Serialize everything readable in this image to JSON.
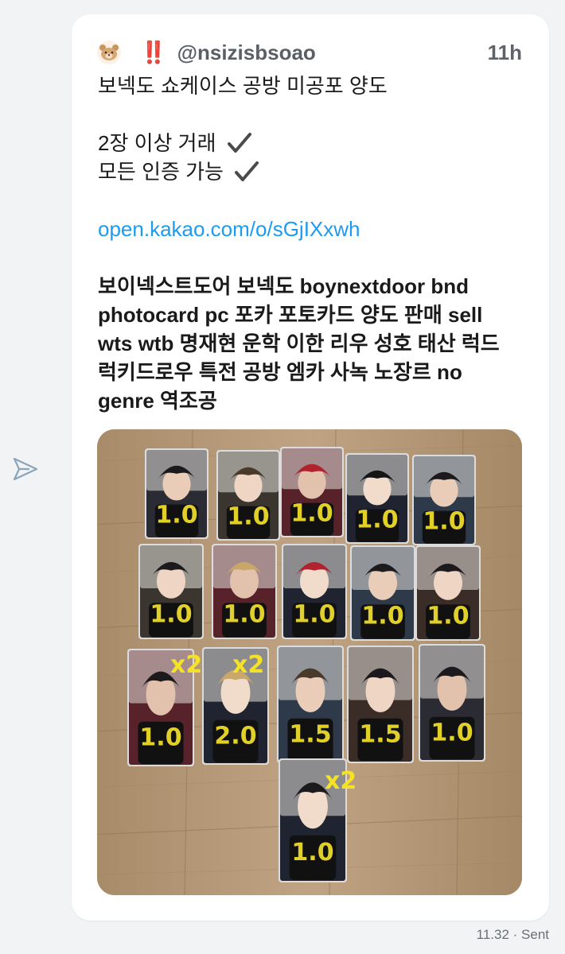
{
  "post": {
    "handle": "@nsizisbsoao",
    "time": "11h",
    "badge": "‼️",
    "lines": [
      "보넥도 쇼케이스 공방 미공포 양도",
      "2장 이상 거래",
      "모든 인증 가능"
    ],
    "link": "open.kakao.com/o/sGjIXxwh",
    "tag_lines": [
      "보이넥스트도어 보넥도 boynextdoor bnd",
      "photocard pc 포카 포토카드 양도 판매 sell",
      "wts wtb 명재현 운학 이한 리우 성호 태산 럭드",
      "럭키드로우 특전 공방 엠카 사녹 노장르 no",
      "genre 역조공"
    ]
  },
  "photo": {
    "alt": "photocards",
    "row1": [
      "1.0",
      "1.0",
      "1.0",
      "1.0",
      "1.0"
    ],
    "row2": [
      "1.0",
      "1.0",
      "1.0",
      "1.0",
      "1.0"
    ],
    "row3": [
      "1.0",
      "2.0",
      "1.5",
      "1.5",
      "1.0"
    ],
    "row3_marks": [
      "x2",
      "x2"
    ],
    "row4": [
      "1.0"
    ],
    "row4_marks": [
      "x2"
    ]
  },
  "footer": {
    "status": "11.32 · Sent"
  },
  "colors": {
    "link": "#1d9bf0",
    "badge": "#e0243a",
    "marker": "#f3e12a"
  }
}
